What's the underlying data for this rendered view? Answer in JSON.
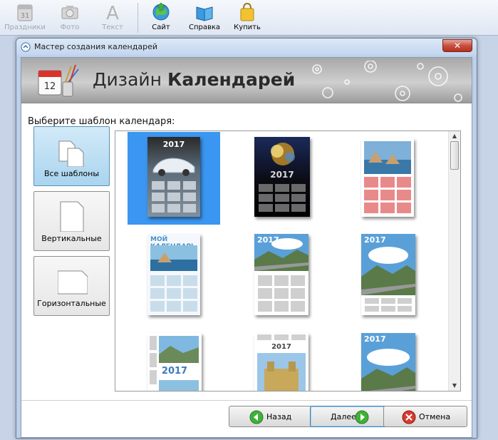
{
  "toolbar": {
    "items": [
      {
        "label": "Праздники",
        "icon": "calendar-icon",
        "enabled": false
      },
      {
        "label": "Фото",
        "icon": "camera-icon",
        "enabled": false
      },
      {
        "label": "Текст",
        "icon": "text-icon",
        "enabled": false
      },
      {
        "label": "Сайт",
        "icon": "globe-icon",
        "enabled": true
      },
      {
        "label": "Справка",
        "icon": "book-icon",
        "enabled": true
      },
      {
        "label": "Купить",
        "icon": "shopping-bag-icon",
        "enabled": true
      }
    ]
  },
  "dialog": {
    "title": "Мастер создания календарей",
    "close_label": "✕",
    "header": {
      "title_light": "Дизайн",
      "title_bold": "Календарей"
    },
    "prompt": "Выберите шаблон календаря:",
    "categories": [
      {
        "label": "Все шаблоны",
        "selected": true
      },
      {
        "label": "Вертикальные",
        "selected": false
      },
      {
        "label": "Горизонтальные",
        "selected": false
      }
    ],
    "templates": [
      {
        "year": "2017",
        "selected": true
      },
      {
        "year": "2017",
        "selected": false
      },
      {
        "year": "",
        "selected": false
      },
      {
        "year": "МОЙ КАЛЕНДАРЬ",
        "selected": false
      },
      {
        "year": "2017",
        "selected": false
      },
      {
        "year": "2017",
        "selected": false
      },
      {
        "year": "2017",
        "selected": false
      },
      {
        "year": "2017",
        "selected": false
      },
      {
        "year": "2017",
        "selected": false
      }
    ],
    "buttons": {
      "back": "Назад",
      "next": "Далее",
      "cancel": "Отмена"
    }
  },
  "colors": {
    "selection": "#3a96f0",
    "accent": "#3c7fb1",
    "close": "#c75040"
  }
}
